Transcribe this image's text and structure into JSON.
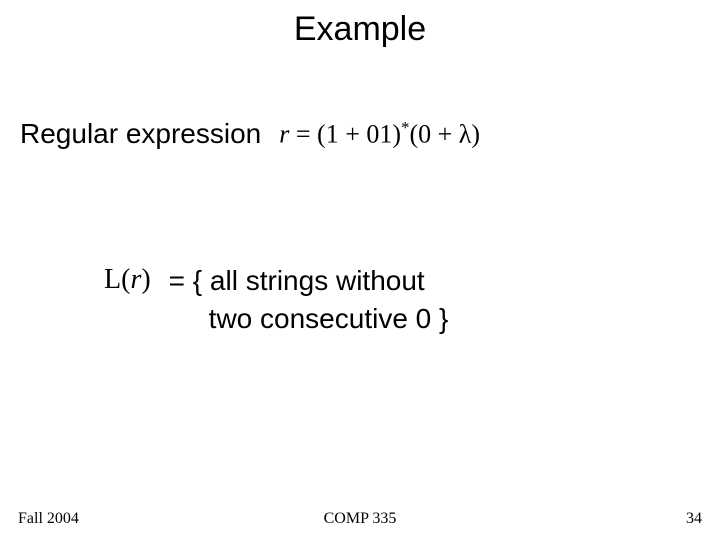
{
  "slide": {
    "title": "Example",
    "line1_label": "Regular expression",
    "regex_lhs_var": "r",
    "regex_eq": " = ",
    "regex_group1": "(1 + 01)",
    "regex_star": "*",
    "regex_group2": "(0 + λ)",
    "lr_L": "L",
    "lr_open": "(",
    "lr_var": "r",
    "lr_close": ")",
    "desc_line1": "= { all strings without",
    "desc_line2": "two consecutive 0 }"
  },
  "footer": {
    "left": "Fall 2004",
    "center": "COMP 335",
    "right": "34"
  }
}
